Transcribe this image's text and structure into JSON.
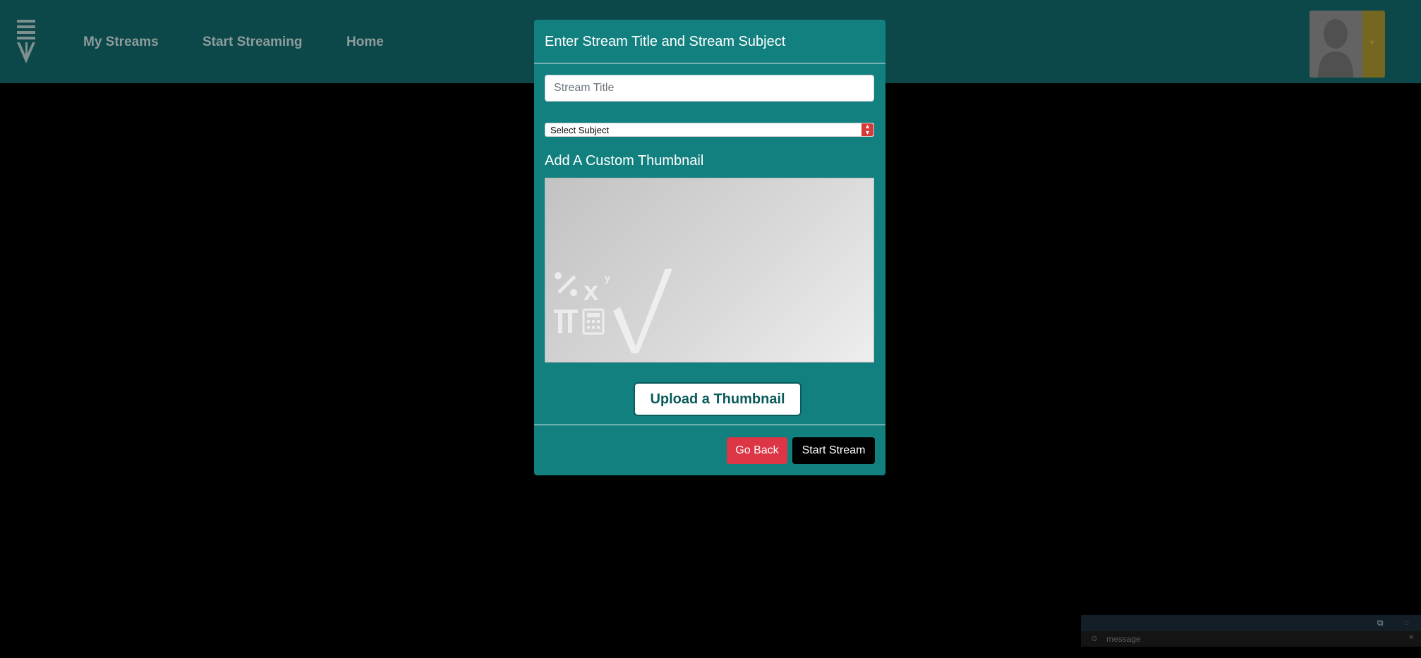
{
  "nav": {
    "links": [
      "My Streams",
      "Start Streaming",
      "Home"
    ],
    "colors": {
      "background": "#0c4749",
      "link": "#8e9c9c"
    }
  },
  "modal": {
    "title": "Enter Stream Title and Stream Subject",
    "title_input_placeholder": "Stream Title",
    "subject_select_value": "Select Subject",
    "thumbnail_heading": "Add A Custom Thumbnail",
    "upload_label": "Upload a Thumbnail",
    "back_label": "Go Back",
    "start_label": "Start Stream",
    "colors": {
      "background": "#138080",
      "back_button": "#dc3545",
      "start_button": "#000000"
    }
  },
  "chat": {
    "input_placeholder": "message",
    "icons": [
      "external-link-icon",
      "emoji-icon",
      "close-icon"
    ]
  }
}
